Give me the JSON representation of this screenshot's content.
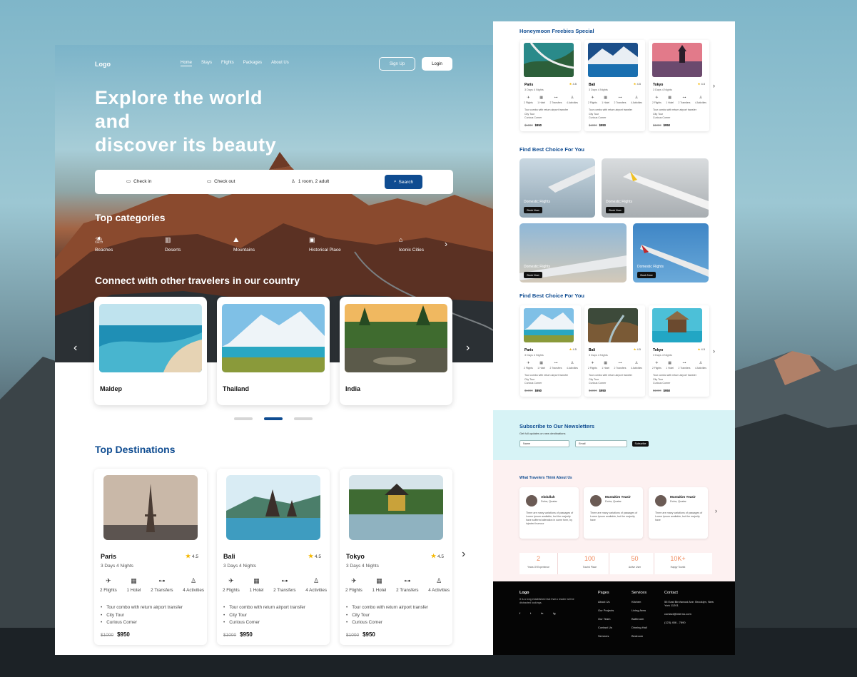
{
  "nav": {
    "logo": "Logo",
    "links": [
      "Home",
      "Stays",
      "Flights",
      "Packages",
      "About Us"
    ],
    "signup": "Sign Up",
    "login": "Login"
  },
  "hero": {
    "title_line1": "Explore the world",
    "title_line2": "and",
    "title_line3": "discover its beauty"
  },
  "search": {
    "checkin": "Check in",
    "checkout": "Check out",
    "guests": "1 room, 2 adult",
    "button": "Search"
  },
  "categories": {
    "title": "Top categories",
    "items": [
      "Beaches",
      "Deserts",
      "Mountains",
      "Historical Place",
      "Iconic Cities"
    ]
  },
  "connect": {
    "title": "Connect with other travelers in our country",
    "cards": [
      "Maldep",
      "Thailand",
      "India"
    ]
  },
  "destinations": {
    "title": "Top Destinations",
    "cards": [
      {
        "name": "Paris",
        "rating": "4.5",
        "duration": "3 Days 4 Nights",
        "feats": [
          "2 Flights",
          "1 Hotel",
          "2 Transfers",
          "4 Activities"
        ],
        "list": [
          "Tour combo with return airport transfer",
          "City Tour",
          "Curious Corner"
        ],
        "old": "$1000",
        "price": "$950"
      },
      {
        "name": "Bali",
        "rating": "4.5",
        "duration": "3 Days 4 Nights",
        "feats": [
          "2 Flights",
          "1 Hotel",
          "2 Transfers",
          "4 Activities"
        ],
        "list": [
          "Tour combo with return airport transfer",
          "City Tour",
          "Curious Corner"
        ],
        "old": "$1000",
        "price": "$950"
      },
      {
        "name": "Tokyo",
        "rating": "4.5",
        "duration": "3 Days 4 Nights",
        "feats": [
          "2 Flights",
          "1 Hotel",
          "2 Transfers",
          "4 Activities"
        ],
        "list": [
          "Tour combo with return airport transfer",
          "City Tour",
          "Curious Corner"
        ],
        "old": "$1000",
        "price": "$950"
      }
    ]
  },
  "right": {
    "honeymoon_title": "Honeymoon Freebies Special",
    "honeymoon": [
      {
        "name": "Paris",
        "rating": "4.5",
        "duration": "3 Days 4 Nights",
        "feats": [
          "2 Flights",
          "1 Hotel",
          "2 Transfers",
          "4 Activities"
        ],
        "list": [
          "Tour combo with return airport transfer",
          "City Tour",
          "Curious Corner"
        ],
        "old": "$1000",
        "price": "$950"
      },
      {
        "name": "Bali",
        "rating": "4.5",
        "duration": "3 Days 4 Nights",
        "feats": [
          "2 Flights",
          "1 Hotel",
          "2 Transfers",
          "4 Activities"
        ],
        "list": [
          "Tour combo with return airport transfer",
          "City Tour",
          "Curious Corner"
        ],
        "old": "$1000",
        "price": "$950"
      },
      {
        "name": "Tokyo",
        "rating": "4.5",
        "duration": "3 Days 4 Nights",
        "feats": [
          "2 Flights",
          "1 Hotel",
          "2 Transfers",
          "4 Activities"
        ],
        "list": [
          "Tour combo with return airport transfer",
          "City Tour",
          "Curious Corner"
        ],
        "old": "$1000",
        "price": "$950"
      }
    ],
    "choice_title": "Find Best Choice For You",
    "flights": [
      {
        "label": "Domestic Flights",
        "btn": "Book Now"
      },
      {
        "label": "Domestic Flights",
        "btn": "Book Now"
      },
      {
        "label": "Domestic Flights",
        "btn": "Book Now"
      },
      {
        "label": "Domestic Flights",
        "btn": "Book Now"
      }
    ],
    "choice2_title": "Find Best Choice For You",
    "choice2": [
      {
        "name": "Paris",
        "rating": "4.5",
        "duration": "3 Days 4 Nights",
        "feats": [
          "2 Flights",
          "1 Hotel",
          "2 Transfers",
          "4 Activities"
        ],
        "list": [
          "Tour combo with return airport transfer",
          "City Tour",
          "Curious Corner"
        ],
        "old": "$1000",
        "price": "$950"
      },
      {
        "name": "Bali",
        "rating": "4.5",
        "duration": "3 Days 4 Nights",
        "feats": [
          "2 Flights",
          "1 Hotel",
          "2 Transfers",
          "4 Activities"
        ],
        "list": [
          "Tour combo with return airport transfer",
          "City Tour",
          "Curious Corner"
        ],
        "old": "$1000",
        "price": "$950"
      },
      {
        "name": "Tokyo",
        "rating": "4.5",
        "duration": "3 Days 4 Nights",
        "feats": [
          "2 Flights",
          "1 Hotel",
          "2 Transfers",
          "4 Activities"
        ],
        "list": [
          "Tour combo with return airport transfer",
          "City Tour",
          "Curious Corner"
        ],
        "old": "$1000",
        "price": "$950"
      }
    ],
    "newsletter": {
      "title": "Subscribe to Our Newsletters",
      "sub": "Get full updates on new destinations",
      "name_ph": "Name",
      "email_ph": "Email",
      "btn": "Subscribe"
    },
    "testimonials": {
      "title": "What Travelers Think About Us",
      "items": [
        {
          "name": "Abdullah",
          "loc": "Doha, Quatar",
          "text": "There are many variations of passages of Lorem Ipsum available, but the majority have suffered alteration in some form, by injected humour"
        },
        {
          "name": "Mustakim Yeasir",
          "loc": "Doha, Quatar",
          "text": "There are many variations of passages of Lorem Ipsum available, but the majority have"
        },
        {
          "name": "Mustakim Yeasir",
          "loc": "Doha, Quatar",
          "text": "There are many variations of passages of Lorem Ipsum available, but the majority have"
        }
      ]
    },
    "stats": [
      {
        "v": "2",
        "k": "Years Of Experience"
      },
      {
        "v": "100",
        "k": "Tourist Place"
      },
      {
        "v": "50",
        "k": "Active User"
      },
      {
        "v": "10K+",
        "k": "Happy Tourist"
      }
    ],
    "footer": {
      "logo": "Logo",
      "desc": "It is a long established fact that a reader will be distracted lookings.",
      "social": [
        "f",
        "t",
        "in",
        "ig"
      ],
      "pages_h": "Pages",
      "pages": [
        "About Us",
        "Our Projects",
        "Our Team",
        "Contact Us",
        "Services"
      ],
      "services_h": "Services",
      "services": [
        "Kitchen",
        "Living Area",
        "Bathroom",
        "Dinning Hall",
        "Bedroom"
      ],
      "contact_h": "Contact",
      "contact": [
        "55 East Birchwood Ave. Brooklyn, New York 11201",
        "contact@interno.com",
        "(123) 456 - 7890"
      ]
    }
  },
  "colors": {
    "brand": "#0f4c91",
    "accent": "#f08a5d",
    "star": "#f5b800"
  }
}
